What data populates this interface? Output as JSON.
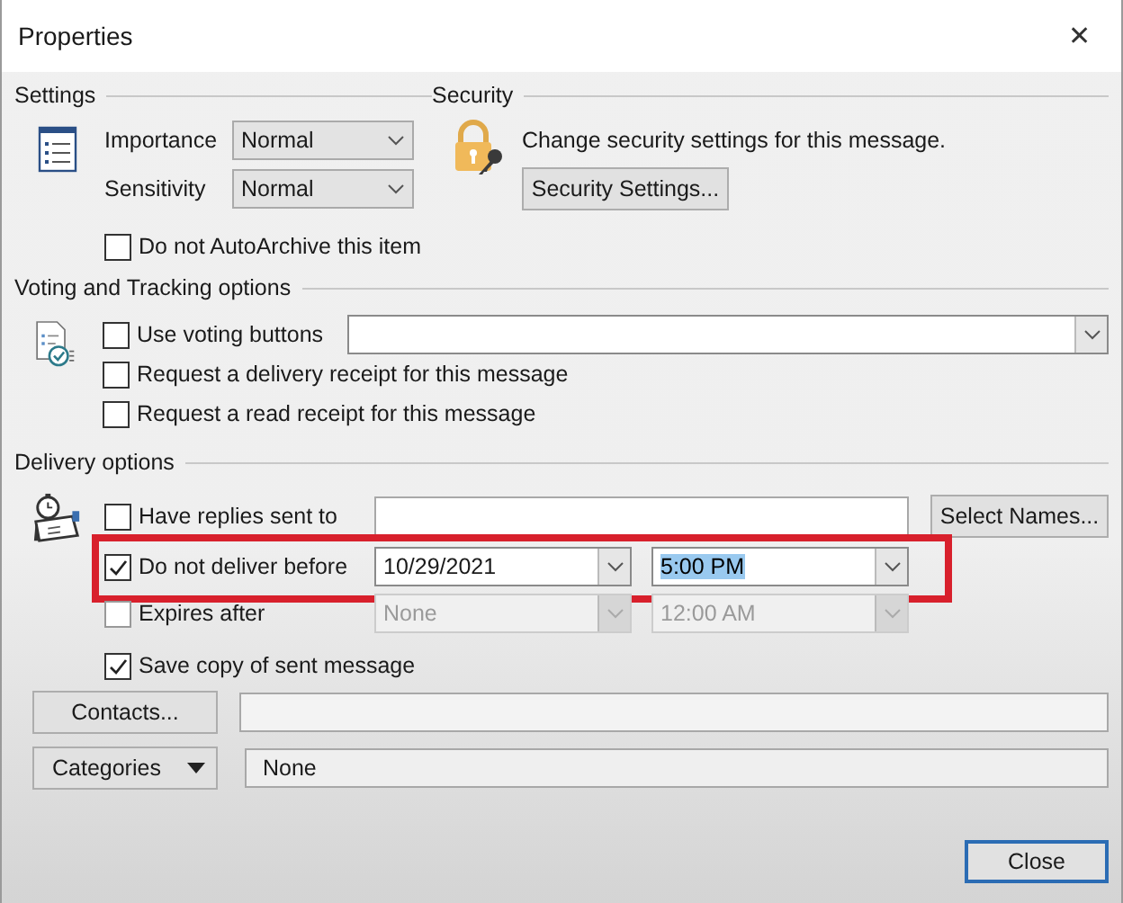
{
  "window": {
    "title": "Properties",
    "close": "✕"
  },
  "settings": {
    "heading": "Settings",
    "importance": {
      "label": "Importance",
      "value": "Normal"
    },
    "sensitivity": {
      "label": "Sensitivity",
      "value": "Normal"
    },
    "autoarchive": {
      "label": "Do not AutoArchive this item",
      "checked": false
    }
  },
  "security": {
    "heading": "Security",
    "text": "Change security settings for this message.",
    "button": "Security Settings..."
  },
  "voting": {
    "heading": "Voting and Tracking options",
    "use_voting": {
      "label": "Use voting buttons",
      "checked": false
    },
    "receipts": [
      {
        "label": "Request a delivery receipt for this message",
        "checked": false
      },
      {
        "label": "Request a read receipt for this message",
        "checked": false
      }
    ]
  },
  "delivery": {
    "heading": "Delivery options",
    "have_replies": {
      "label": "Have replies sent to",
      "checked": false
    },
    "select_names": "Select Names...",
    "deliver_before": {
      "label": "Do not deliver before",
      "checked": true,
      "date": "10/29/2021",
      "time": "5:00 PM",
      "time_selected": true,
      "highlighted": true
    },
    "expires_after": {
      "label": "Expires after",
      "checked": false,
      "disabled": true,
      "date": "None",
      "time": "12:00 AM"
    },
    "save_copy": {
      "label": "Save copy of sent message",
      "checked": true
    }
  },
  "contacts": {
    "button": "Contacts..."
  },
  "categories": {
    "button": "Categories",
    "value": "None"
  },
  "buttons": [
    {
      "label": "Close",
      "default": true
    }
  ]
}
